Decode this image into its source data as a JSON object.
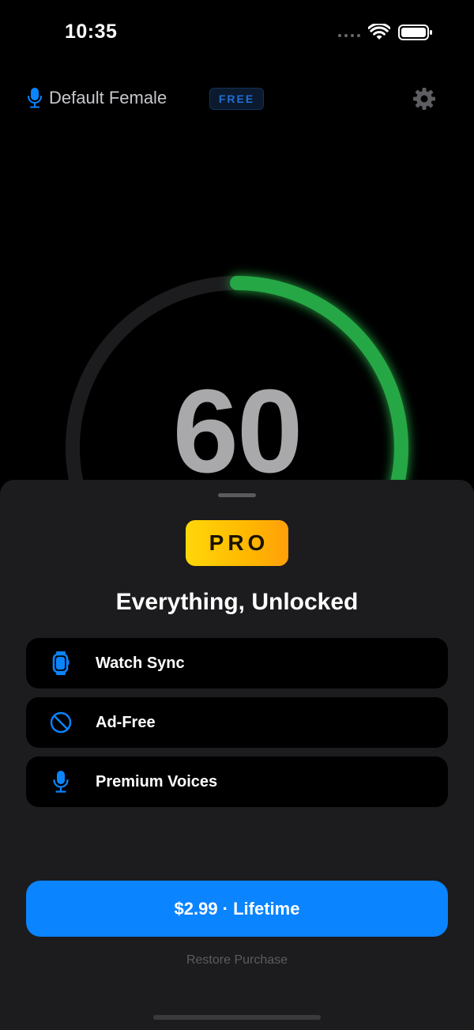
{
  "status_bar": {
    "time": "10:35",
    "icons": [
      "cellular-dots-icon",
      "wifi-icon",
      "battery-icon"
    ]
  },
  "header": {
    "voice_icon": "microphone-icon",
    "voice_name": "Default Female",
    "plan_badge": "FREE",
    "settings_icon": "gear-icon"
  },
  "timer": {
    "value": "60",
    "progress_fraction": 0.33
  },
  "paywall": {
    "badge": "PRO",
    "title": "Everything, Unlocked",
    "features": [
      {
        "icon": "apple-watch-icon",
        "label": "Watch Sync"
      },
      {
        "icon": "prohibited-icon",
        "label": "Ad-Free"
      },
      {
        "icon": "microphone-icon",
        "label": "Premium Voices"
      }
    ],
    "purchase_label": "$2.99 · Lifetime",
    "restore_label": "Restore Purchase"
  },
  "colors": {
    "accent": "#0a84ff",
    "progress": "#28a745",
    "ring_track": "#1c1c1e",
    "pro_gold": "#ffc400"
  }
}
